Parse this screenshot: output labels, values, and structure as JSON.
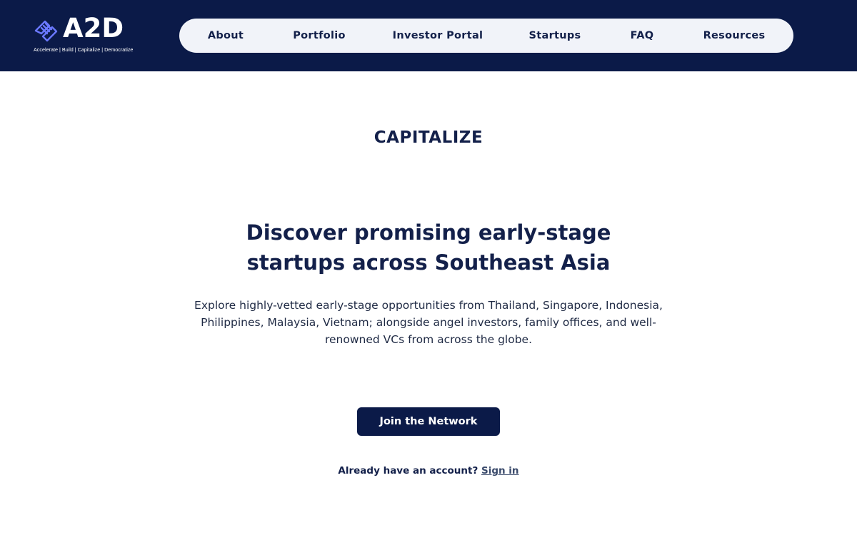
{
  "brand": {
    "name": "A2D",
    "tagline": "Accelerate | Build | Capitalize | Democratize",
    "logo_icon": "handshake-icon"
  },
  "nav": {
    "items": [
      {
        "label": "About"
      },
      {
        "label": "Portfolio"
      },
      {
        "label": "Investor Portal"
      },
      {
        "label": "Startups"
      },
      {
        "label": "FAQ"
      },
      {
        "label": "Resources"
      }
    ]
  },
  "hero": {
    "eyebrow": "CAPITALIZE",
    "headline_line1": "Discover promising early-stage",
    "headline_line2": "startups across Southeast Asia",
    "description": "Explore highly-vetted early-stage opportunities from Thailand, Singapore, Indonesia, Philippines, Malaysia, Vietnam; alongside angel investors, family offices, and well-renowned VCs from across the globe.",
    "cta_label": "Join the Network",
    "signin_prompt": "Already have an account?",
    "signin_link": "Sign in"
  },
  "colors": {
    "header_bg": "#0b1a48",
    "nav_bg": "#f1f3f9",
    "primary_text": "#13204a",
    "logo_accent": "#6a78ff"
  }
}
